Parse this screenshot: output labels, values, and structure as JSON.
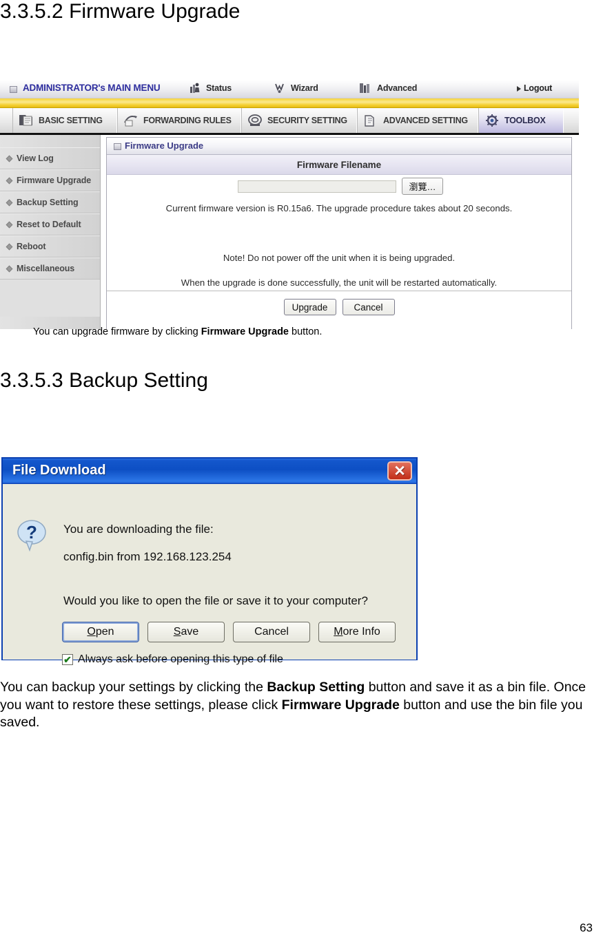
{
  "document": {
    "heading_firmware": "3.3.5.2 Firmware Upgrade",
    "heading_backup": "3.3.5.3 Backup Setting",
    "caption_firmware_prefix": "You can upgrade firmware by clicking ",
    "caption_firmware_bold": "Firmware Upgrade",
    "caption_firmware_suffix": " button.",
    "paragraph_backup_1": "You can backup your settings by clicking the ",
    "paragraph_backup_bold_1": "Backup Setting",
    "paragraph_backup_2": " button and save it as a bin file. Once you want to restore these settings, please click ",
    "paragraph_backup_bold_2": "Firmware Upgrade",
    "paragraph_backup_3": " button and use the bin file you saved.",
    "page_number": "63"
  },
  "router": {
    "adminbar": {
      "title": "ADMINISTRATOR's MAIN MENU",
      "items": [
        {
          "label": "Status",
          "icon": "status-icon"
        },
        {
          "label": "Wizard",
          "icon": "wizard-icon"
        },
        {
          "label": "Advanced",
          "icon": "advanced-icon"
        }
      ],
      "logout": "Logout"
    },
    "tabs": [
      {
        "label": "BASIC SETTING",
        "icon": "folder-icon",
        "active": false
      },
      {
        "label": "FORWARDING RULES",
        "icon": "forwarding-icon",
        "active": false
      },
      {
        "label": "SECURITY SETTING",
        "icon": "shield-icon",
        "active": false
      },
      {
        "label": "ADVANCED SETTING",
        "icon": "advanced-setting-icon",
        "active": false
      },
      {
        "label": "TOOLBOX",
        "icon": "toolbox-icon",
        "active": true
      }
    ],
    "sidebar": {
      "items": [
        {
          "label": "View Log"
        },
        {
          "label": "Firmware Upgrade"
        },
        {
          "label": "Backup Setting"
        },
        {
          "label": "Reset to Default"
        },
        {
          "label": "Reboot"
        },
        {
          "label": "Miscellaneous"
        }
      ]
    },
    "panel": {
      "title": "Firmware Upgrade",
      "column_header": "Firmware Filename",
      "filename_value": "",
      "filename_placeholder": "",
      "browse_label": "瀏覽…",
      "note_version": "Current firmware version is R0.15a6. The upgrade procedure takes about 20 seconds.",
      "note_power": "Note! Do not power off the unit when it is being upgraded.",
      "note_restart": "When the upgrade is done successfully, the unit will be restarted automatically.",
      "upgrade_label": "Upgrade",
      "cancel_label": "Cancel"
    }
  },
  "dialog": {
    "title": "File Download",
    "close_label": "✕",
    "line1": "You are downloading the file:",
    "line2": "config.bin from 192.168.123.254",
    "line3": "Would you like to open the file or save it to your computer?",
    "buttons": [
      {
        "label": "Open",
        "accesskey": "O",
        "focused": true
      },
      {
        "label": "Save",
        "accesskey": "S",
        "focused": false
      },
      {
        "label": "Cancel",
        "accesskey": "",
        "focused": false
      },
      {
        "label": "More Info",
        "accesskey": "M",
        "focused": false
      }
    ],
    "checkbox_label": "Always ask before opening this type of file",
    "checkbox_checked": true,
    "check_glyph": "✔"
  },
  "colors": {
    "admin_title": "#2d2d9e",
    "yellow_strip": "#f5d33c",
    "tab_active": "#bdb9e0",
    "panel_title": "#3b3b86",
    "dialog_title_bar": "#0d4fc4",
    "dialog_close": "#c22e18",
    "dialog_body": "#e9e9dd"
  }
}
